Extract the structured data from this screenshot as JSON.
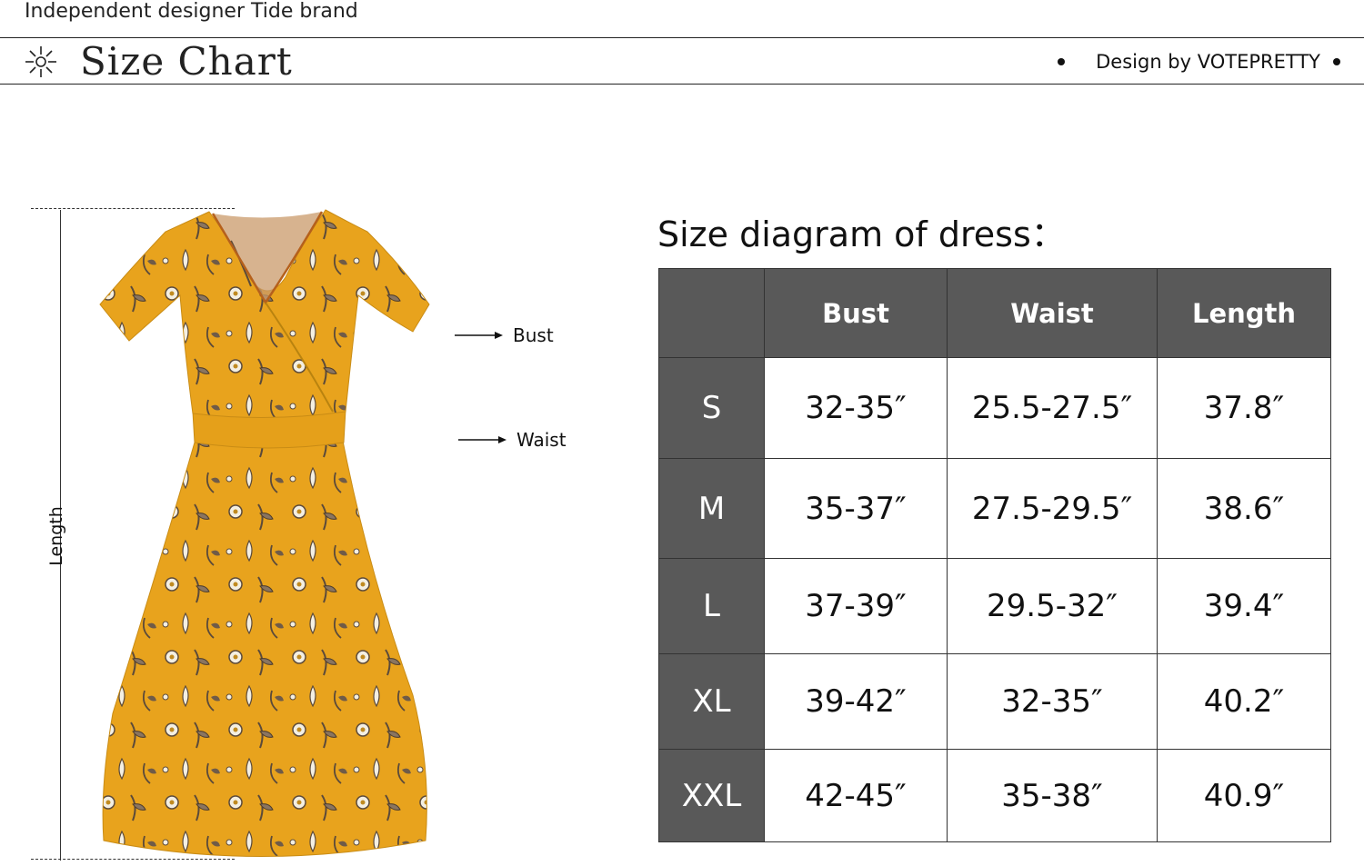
{
  "header": {
    "brand_tagline": "Independent designer Tide brand",
    "title": "Size Chart",
    "design_by": "Design by VOTEPRETTY"
  },
  "dress": {
    "labels": {
      "bust": "Bust",
      "waist": "Waist",
      "length": "Length"
    },
    "colors": {
      "fabric": "#E8A31D",
      "print": "#5b4a3a"
    }
  },
  "size_table": {
    "heading": "Size diagram of dress：",
    "columns": [
      "",
      "Bust",
      "Waist",
      "Length"
    ],
    "rows": [
      {
        "size": "S",
        "bust": "32-35″",
        "waist": "25.5-27.5″",
        "length": "37.8″"
      },
      {
        "size": "M",
        "bust": "35-37″",
        "waist": "27.5-29.5″",
        "length": "38.6″"
      },
      {
        "size": "L",
        "bust": "37-39″",
        "waist": "29.5-32″",
        "length": "39.4″"
      },
      {
        "size": "XL",
        "bust": "39-42″",
        "waist": "32-35″",
        "length": "40.2″"
      },
      {
        "size": "XXL",
        "bust": "42-45″",
        "waist": "35-38″",
        "length": "40.9″"
      }
    ],
    "header_color": "#595959"
  }
}
